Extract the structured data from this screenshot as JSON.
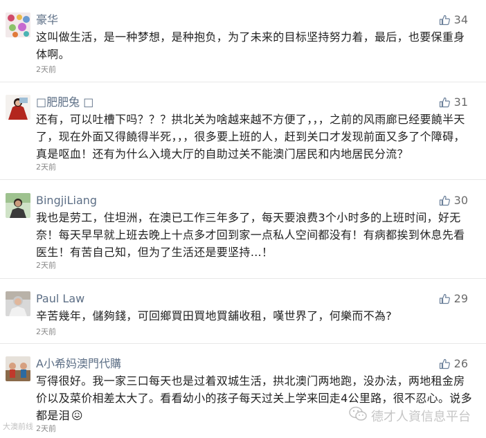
{
  "comments": [
    {
      "username": "豪华",
      "likes": "34",
      "text": "这叫做生活，是一种梦想，是种抱负，为了未来的目标坚持努力着，最后，也要保重身体啊。",
      "time": "2天前"
    },
    {
      "username": "□肥肥兔 □",
      "likes": "31",
      "text": "还有，可以吐槽下吗？？？拱北关为啥越来越不方便了，，，之前的风雨廊已经要饒半天了，现在外面又得饒得半死，，，很多要上班的人，赶到关口才发现前面又多了个障碍，真是呕血！还有为什么入境大厅的自助过关不能澳门居民和内地居民分流？",
      "time": "2天前"
    },
    {
      "username": "BingjiLiang",
      "likes": "30",
      "text": "我也是劳工，住坦洲，在澳已工作三年多了，每天要浪费3个小时多的上班时间，好无奈！每天早早就上班去晚上十点多才回到家一点私人空间都没有！有病都挨到休息先看医生！有苦自己知，但为了生活还是要坚持…！",
      "time": "2天前"
    },
    {
      "username": "Paul Law",
      "likes": "29",
      "text": "辛苦幾年，儲夠錢，可回鄉買田買地買舖收租，嘆世界了，何樂而不為?",
      "time": "2天前"
    },
    {
      "username": "A小希妈澳門代購",
      "likes": "26",
      "text": "写得很好。我一家三口每天也是过着双城生活，拱北澳门两地跑，没办法，两地租金房价以及菜价相差太大了。看看幼小的孩子每天过关上学来回走4公里路，很不忍心。说多都是泪",
      "emoji": "😖",
      "time": "2天前"
    }
  ],
  "watermark": {
    "text": "德才人資信息平台",
    "left_text": "大澳前线"
  },
  "colors": {
    "username": "#5d6f86",
    "text": "#222222",
    "time": "#888888",
    "likes": "#6b6b6b",
    "thumb": "#6a7f99"
  }
}
